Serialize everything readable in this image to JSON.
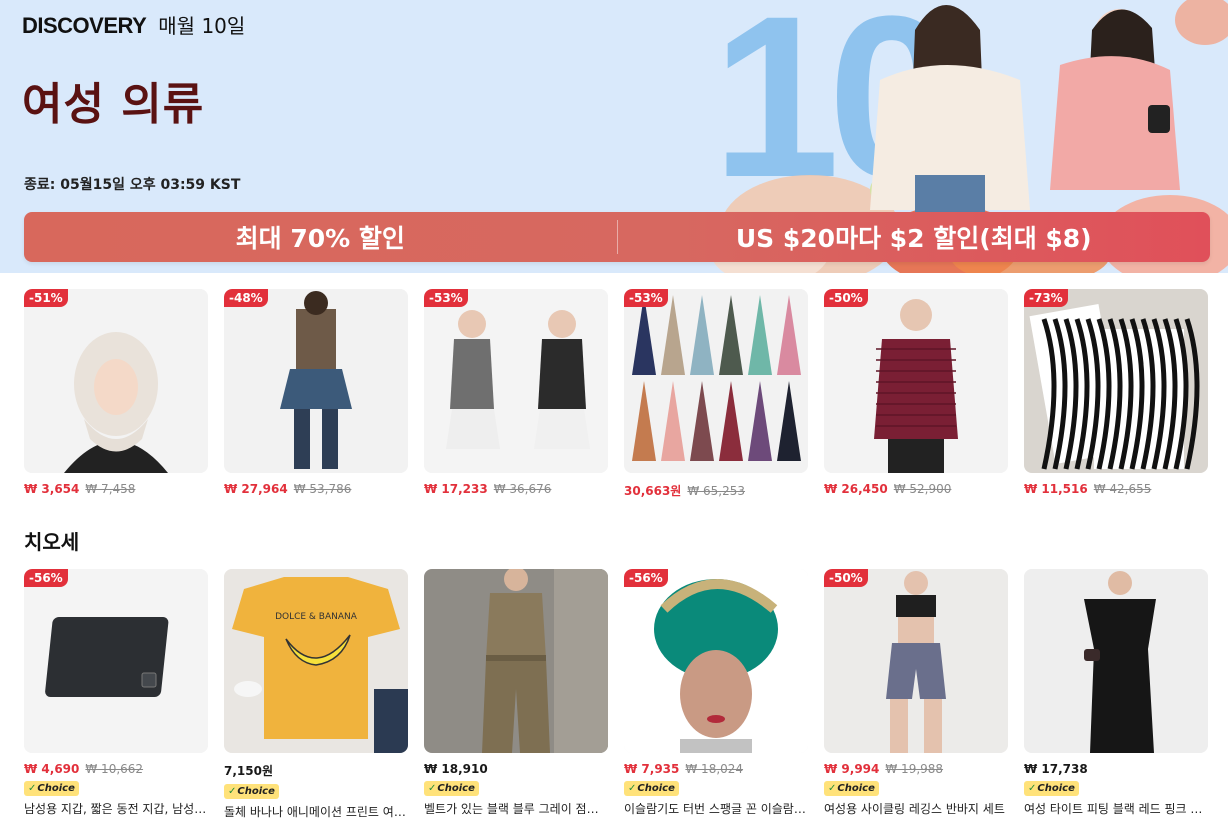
{
  "banner": {
    "brand": "DISCOVERY",
    "brand_sub": "매월 10일",
    "title": "여성 의류",
    "ends": "종료: 05월15일 오후 03:59 KST",
    "big_number": "10",
    "promo_left": "최대 70% 할인",
    "promo_right": "US $20마다 $2 할인(최대 $8)"
  },
  "row1": [
    {
      "badge": "-51%",
      "price": "₩ 3,654",
      "orig": "₩ 7,458",
      "image": "white-hijab-cap"
    },
    {
      "badge": "-48%",
      "price": "₩ 27,964",
      "orig": "₩ 53,786",
      "image": "floral-top-denim-skirt"
    },
    {
      "badge": "-53%",
      "price": "₩ 17,233",
      "orig": "₩ 36,676",
      "image": "blazer-ruffle-skirt"
    },
    {
      "badge": "-53%",
      "price": "30,663원",
      "orig": "₩ 65,253",
      "image": "abaya-set"
    },
    {
      "badge": "-50%",
      "price": "₩ 26,450",
      "orig": "₩ 52,900",
      "image": "burgundy-puffer-jacket"
    },
    {
      "badge": "-73%",
      "price": "₩ 11,516",
      "orig": "₩ 42,655",
      "image": "zebra-leggings"
    }
  ],
  "section_title": "치오세",
  "row2": [
    {
      "badge": "-56%",
      "price": "₩ 4,690",
      "orig": "₩ 10,662",
      "sale": true,
      "choice": "Choice",
      "name": "남성용 지갑, 짧은 동전 지갑, 남성용 카드 지갑",
      "image": "black-wallet"
    },
    {
      "badge": "",
      "price": "7,150원",
      "orig": "",
      "sale": false,
      "choice": "Choice",
      "name": "돌체 바나나 애니메이션 프린트 여성 티셔츠",
      "image": "banana-tshirt"
    },
    {
      "badge": "",
      "price": "₩ 18,910",
      "orig": "",
      "sale": false,
      "choice": "Choice",
      "name": "벨트가 있는 블랙 블루 그레이 점프수트",
      "image": "khaki-jumpsuit"
    },
    {
      "badge": "-56%",
      "price": "₩ 7,935",
      "orig": "₩ 18,024",
      "sale": true,
      "choice": "Choice",
      "name": "이슬람기도 터번 스팽글 꼰 이슬람 모자",
      "image": "green-turban"
    },
    {
      "badge": "-50%",
      "price": "₩ 9,994",
      "orig": "₩ 19,988",
      "sale": true,
      "choice": "Choice",
      "name": "여성용 사이클링 레깅스 반바지 세트",
      "image": "cycling-shorts"
    },
    {
      "badge": "",
      "price": "₩ 17,738",
      "orig": "",
      "sale": false,
      "choice": "Choice",
      "name": "여성 타이트 피팅 블랙 레드 핑크 원피스",
      "image": "black-dress"
    }
  ]
}
